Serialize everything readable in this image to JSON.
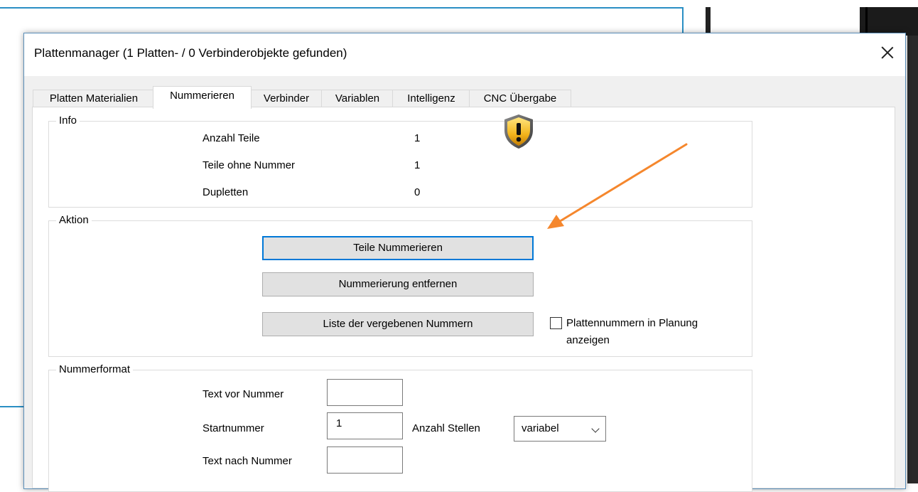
{
  "dialog": {
    "title": "Plattenmanager (1 Platten- / 0 Verbinderobjekte gefunden)",
    "tabs": [
      "Platten Materialien",
      "Nummerieren",
      "Verbinder",
      "Variablen",
      "Intelligenz",
      "CNC Übergabe"
    ],
    "active_tab": "Nummerieren"
  },
  "info": {
    "legend": "Info",
    "rows": [
      {
        "label": "Anzahl Teile",
        "value": "1"
      },
      {
        "label": "Teile ohne Nummer",
        "value": "1"
      },
      {
        "label": "Dupletten",
        "value": "0"
      }
    ],
    "icon": "warning-shield-icon"
  },
  "aktion": {
    "legend": "Aktion",
    "btn_number": "Teile Nummerieren",
    "btn_remove": "Nummerierung entfernen",
    "btn_list": "Liste der vergebenen Nummern",
    "checkbox_label_1": "Plattennummern in Planung",
    "checkbox_label_2": "anzeigen",
    "checkbox_checked": false
  },
  "nummerformat": {
    "legend": "Nummerformat",
    "text_vor_label": "Text vor Nummer",
    "text_vor_value": "",
    "start_label": "Startnummer",
    "start_value": "1",
    "stellen_label": "Anzahl Stellen",
    "stellen_value": "variabel",
    "text_nach_label": "Text nach Nummer",
    "text_nach_value": ""
  },
  "colors": {
    "accent": "#0078d7",
    "arrow": "#f5872d",
    "frame": "#2a8fc4"
  }
}
